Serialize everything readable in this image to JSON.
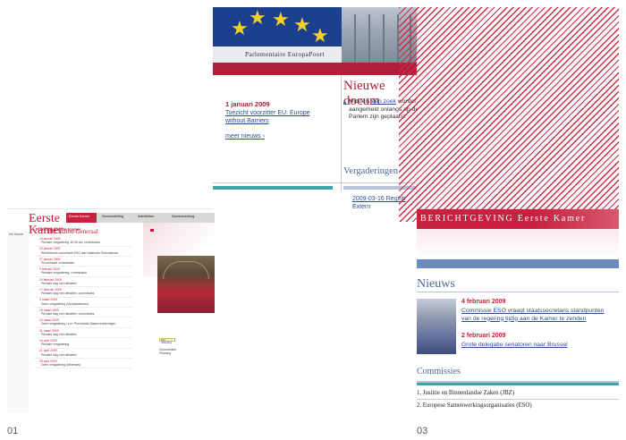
{
  "colors": {
    "accent_red": "#c8203e",
    "link_blue": "#2a4e90",
    "teal": "#3aa7a8",
    "eu_blue": "#1c3f8e"
  },
  "panel_02": {
    "site_title": "Parlementaire EuropaPoort",
    "news_date": "1 januari 2009",
    "news_link": "Toezicht voorzitter EU: Europe without Barriers",
    "more_news": "meer nieuws ›",
    "heading_new_docs": "Nieuwe docum",
    "new_docs_text_prefix": "Middels",
    "new_docs_link": "een zoek",
    "new_docs_text_suffix": "worden aangemeld onlangs op de Parlem zijn geplaatst",
    "heading_meetings": "Vergaderingen",
    "meeting_entry": "2009-03-16 Regels Extern"
  },
  "panel_01": {
    "logo_line1": "Eerste",
    "logo_line2": "Kamer",
    "logo_sub": "der Staten-Generaal",
    "nav_items": [
      "Eerste Kamer",
      "Samenstelling",
      "Activiteiten",
      "Samenwerking"
    ],
    "sidebar_label": "Uw Kamer",
    "main_title": "Planning Eerste Kamer",
    "entries": [
      {
        "date": "13 januari 2009",
        "text": "Plenaire vergadering 15.00 uur, commissies"
      },
      {
        "date": "20 januari 2009",
        "text": "Werkbezoek commissie ESO aan Nationale Ombudsman"
      },
      {
        "date": "27 januari 2009",
        "text": "Procedurele commissies"
      },
      {
        "date": "3 februari 2009",
        "text": "Plenaire vergadering, commissies"
      },
      {
        "date": "10 februari 2009",
        "text": "Plenaire dag met debatten"
      },
      {
        "date": "17 februari 2009",
        "text": "Plenaire dag met debatten, commissies"
      },
      {
        "date": "3 maart 2009",
        "text": "Geen vergadering (Voorjaarsreces)"
      },
      {
        "date": "10 maart 2009",
        "text": "Plenaire dag met debatten, commissies"
      },
      {
        "date": "24 maart 2009",
        "text": "Geen vergadering i.v.m. Provinciale Statenverkiezingen"
      },
      {
        "date": "31 maart 2009",
        "text": "Plenaire dag met debatten"
      },
      {
        "date": "14 april 2009",
        "text": "Plenaire vergadering"
      },
      {
        "date": "21 april 2009",
        "text": "Plenaire dag met debatten"
      },
      {
        "date": "28 april 2009",
        "text": "Geen vergadering (Meireces)"
      }
    ],
    "side_button": "Live uitzending",
    "side_box": "Documenten\nPlanning"
  },
  "panel_03": {
    "header": "BERICHTGEVING Eerste Kamer",
    "heading_news": "Nieuws",
    "item1_date": "4 februari 2009",
    "item1_link": "Commissie ESO vraagt staatssecretaris standpunten\nvan de regering tijdig aan de Kamer te zenden",
    "item2_date": "2 februari 2009",
    "item2_link": "Grote delegatie senatoren naar Brussel",
    "heading_committees": "Commissies",
    "committee_1": "1. Justitie en Binnenlandse Zaken (JBZ)",
    "committee_2": "2. Europese Samenwerkingsorganisaties (ESO)"
  },
  "captions": {
    "left": "01",
    "right": "03"
  }
}
